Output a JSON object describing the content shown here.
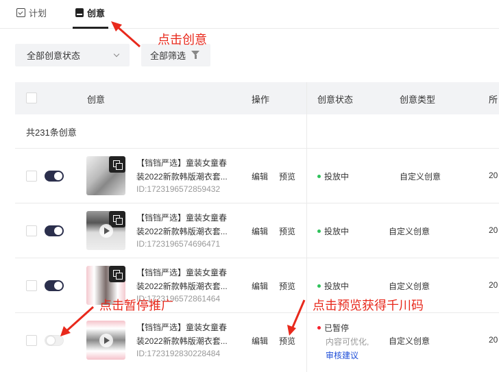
{
  "tabs": [
    {
      "label": "计划",
      "icon": "calendar-check-icon",
      "active": false
    },
    {
      "label": "创意",
      "icon": "creative-icon",
      "active": true
    }
  ],
  "filters": {
    "status_select": "全部创意状态",
    "all_filter": "全部筛选"
  },
  "table": {
    "headers": {
      "creative": "创意",
      "action": "操作",
      "status": "创意状态",
      "type": "创意类型",
      "date_partial": "所"
    },
    "count_text": "共231条创意",
    "rows": [
      {
        "enabled": true,
        "title_l1": "【铛铛严选】童装女童春",
        "title_l2": "装2022新款韩版潮衣套...",
        "id": "ID:1723196572859432",
        "edit": "编辑",
        "preview": "预览",
        "status": "投放中",
        "status_color": "#2fc25b",
        "type": "自定义创意",
        "date_partial": "20"
      },
      {
        "enabled": true,
        "title_l1": "【铛铛严选】童装女童春",
        "title_l2": "装2022新款韩版潮衣套...",
        "id": "ID:1723196574696471",
        "edit": "编辑",
        "preview": "预览",
        "status": "投放中",
        "status_color": "#2fc25b",
        "type": "自定义创意",
        "date_partial": "20"
      },
      {
        "enabled": true,
        "title_l1": "【铛铛严选】童装女童春",
        "title_l2": "装2022新款韩版潮衣套...",
        "id": "ID:1723196572861464",
        "edit": "编辑",
        "preview": "预览",
        "status": "投放中",
        "status_color": "#2fc25b",
        "type": "自定义创意",
        "date_partial": "20"
      },
      {
        "enabled": false,
        "title_l1": "【铛铛严选】童装女童春",
        "title_l2": "装2022新款韩版潮衣套...",
        "id": "ID:1723192830228484",
        "edit": "编辑",
        "preview": "预览",
        "status": "已暂停",
        "status_color": "#f5222d",
        "status_sub": "内容可优化,",
        "status_link": "审核建议",
        "type": "自定义创意",
        "date_partial": "20"
      }
    ]
  },
  "annotations": {
    "click_creative": "点击创意",
    "click_pause": "点击暂停推广",
    "click_preview": "点击预览获得千川码"
  },
  "colors": {
    "annotation": "#e8291c",
    "toggle_on": "#2b2f4c",
    "link": "#1e4ed8"
  }
}
